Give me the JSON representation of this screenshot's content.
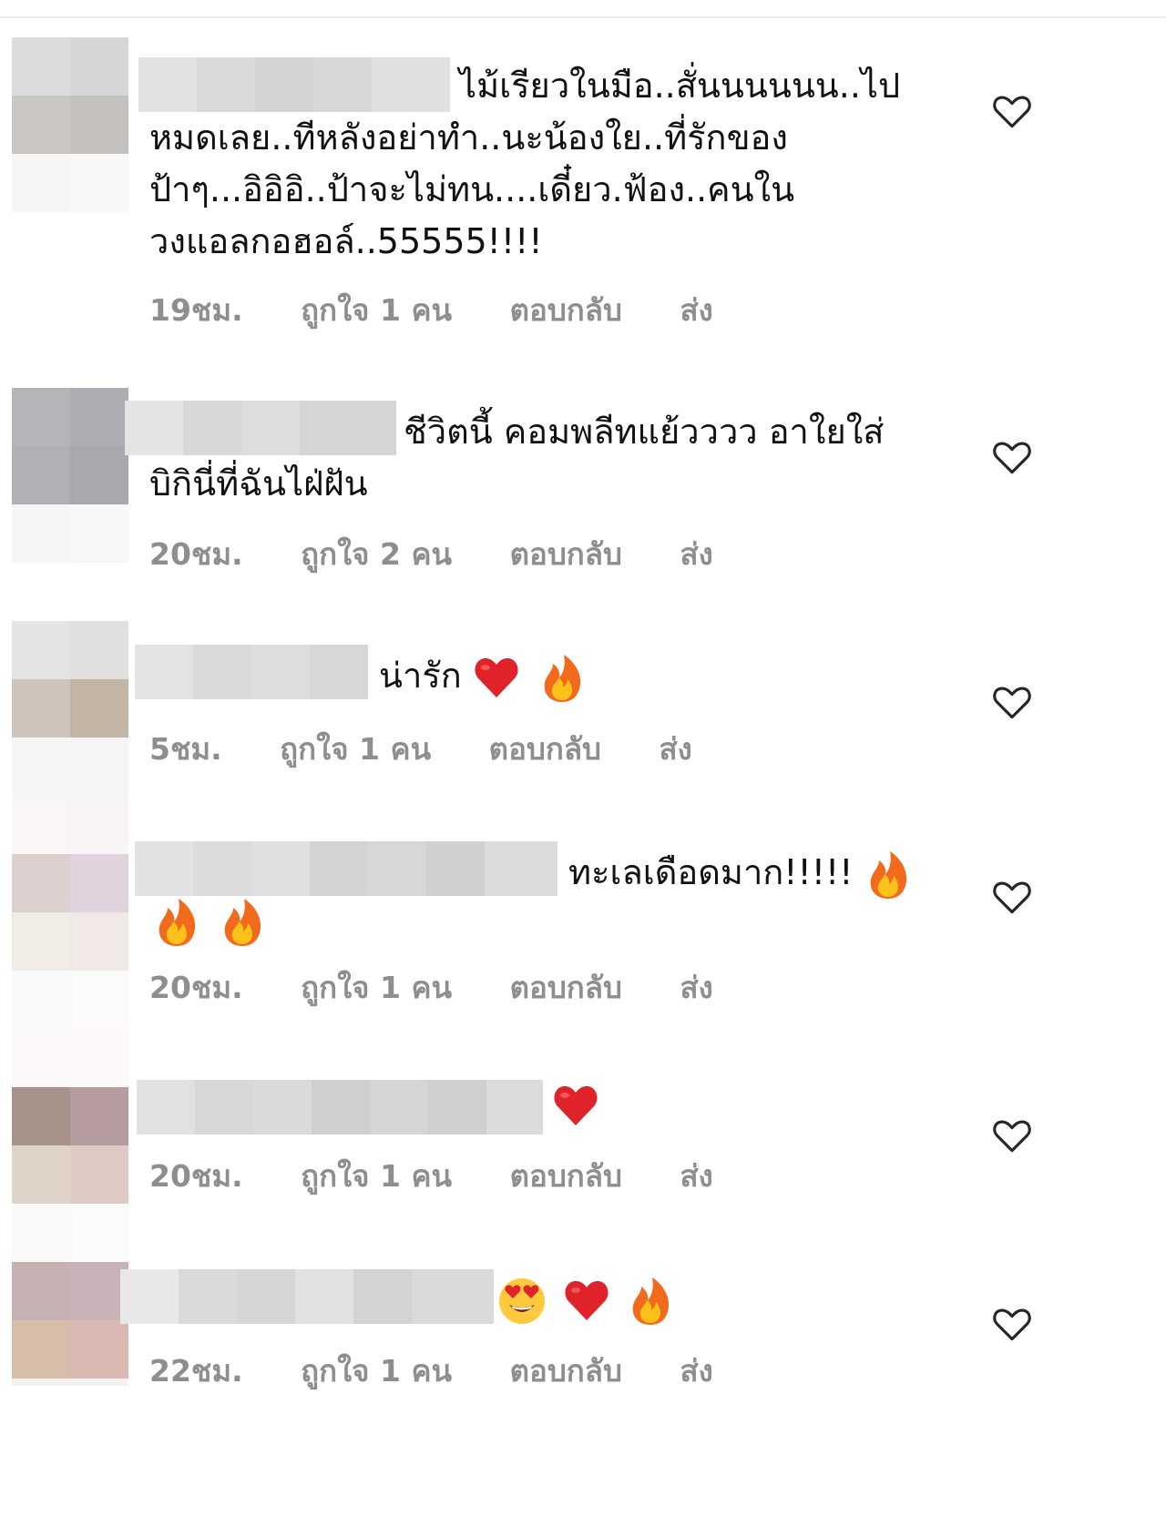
{
  "comments": [
    {
      "lines": [
        "ไม้เรียวในมือ..สั่นนนนนน..ไป",
        "หมดเลย..ทีหลังอย่าทำ..นะน้องใย..ที่รักของ",
        "ป้าๆ...อิอิอิ..ป้าจะไม่ทน....เดี๋ยว.ฟ้อง..คนใน",
        "วงแอลกอฮอล์..55555!!!!"
      ],
      "time": "19ชม.",
      "likes": "ถูกใจ 1 คน",
      "reply": "ตอบกลับ",
      "send": "ส่ง"
    },
    {
      "lines": [
        "ชีวิตนี้ คอมพลีทแย้วววว อาใยใส่",
        "บิกินี่ที่ฉันไฝ่ฝัน"
      ],
      "time": "20ชม.",
      "likes": "ถูกใจ 2 คน",
      "reply": "ตอบกลับ",
      "send": "ส่ง"
    },
    {
      "lines": [
        "น่ารัก"
      ],
      "emojis": [
        "heart",
        "fire"
      ],
      "time": "5ชม.",
      "likes": "ถูกใจ 1 คน",
      "reply": "ตอบกลับ",
      "send": "ส่ง"
    },
    {
      "lines": [
        "ทะเลเดือดมาก!!!!!"
      ],
      "emojis": [
        "fire",
        "fire",
        "fire"
      ],
      "time": "20ชม.",
      "likes": "ถูกใจ 1 คน",
      "reply": "ตอบกลับ",
      "send": "ส่ง"
    },
    {
      "lines": [
        ""
      ],
      "emojis": [
        "heart"
      ],
      "time": "20ชม.",
      "likes": "ถูกใจ 1 คน",
      "reply": "ตอบกลับ",
      "send": "ส่ง"
    },
    {
      "lines": [
        ""
      ],
      "emojis": [
        "heart-eyes",
        "heart",
        "fire"
      ],
      "time": "22ชม.",
      "likes": "ถูกใจ 1 คน",
      "reply": "ตอบกลับ",
      "send": "ส่ง"
    }
  ],
  "icons": {
    "like": "heart-outline-icon",
    "heart_emoji": "#e0222a",
    "fire_outer": "#f26a1b",
    "fire_inner": "#ffc21a",
    "muted_text": "#8e8e8e"
  }
}
